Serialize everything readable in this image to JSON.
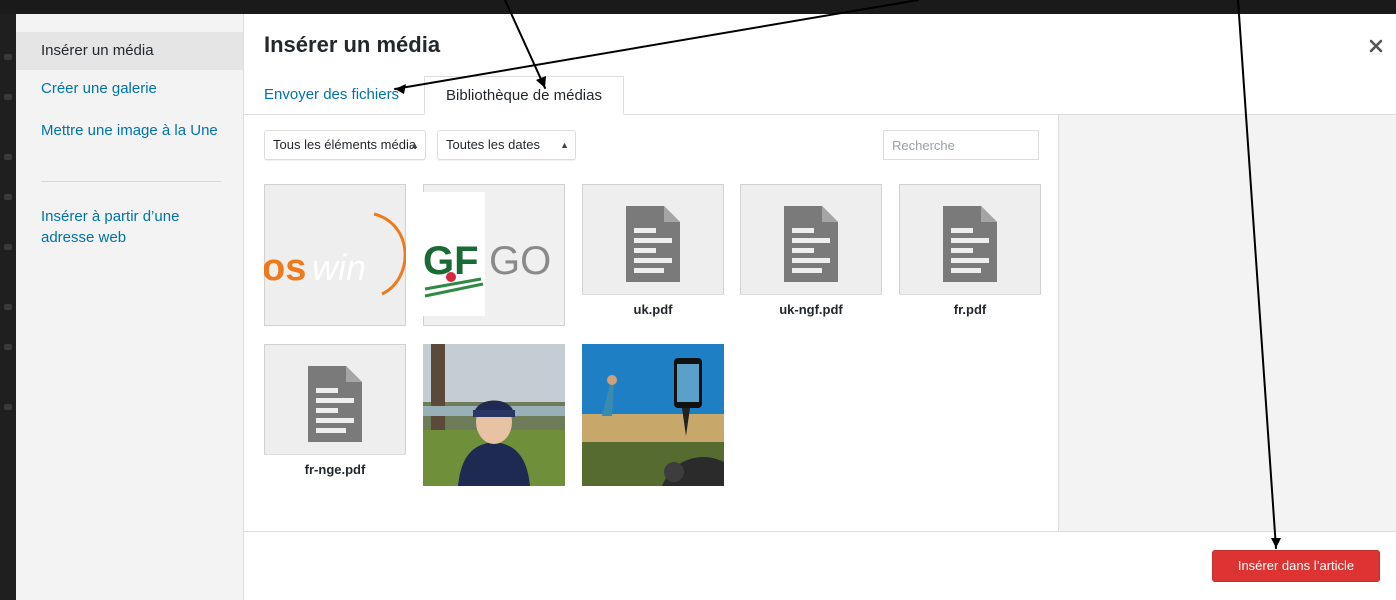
{
  "sidebar": {
    "items": [
      {
        "label": "Insérer un média",
        "active": true
      },
      {
        "label": "Créer une galerie",
        "active": false
      },
      {
        "label": "Mettre une image à la Une",
        "active": false
      },
      {
        "label": "Insérer à partir d’une adresse web",
        "active": false
      }
    ]
  },
  "header": {
    "title": "Insérer un média",
    "close_icon": "close-icon"
  },
  "tabs": [
    {
      "label": "Envoyer des fichiers",
      "active": false
    },
    {
      "label": "Bibliothèque de médias",
      "active": true
    }
  ],
  "toolbar": {
    "type_filter": "Tous les éléments média",
    "date_filter": "Toutes les dates",
    "search_placeholder": "Recherche"
  },
  "media": [
    {
      "kind": "image",
      "name": "oswing-logo"
    },
    {
      "kind": "image",
      "name": "ngf-golf-logo"
    },
    {
      "kind": "document",
      "filename": "uk.pdf"
    },
    {
      "kind": "document",
      "filename": "uk-ngf.pdf"
    },
    {
      "kind": "document",
      "filename": "fr.pdf"
    },
    {
      "kind": "document",
      "filename": "fr-nge.pdf"
    },
    {
      "kind": "image",
      "name": "photo-golfer-cap"
    },
    {
      "kind": "image",
      "name": "photo-golf-swing-phone"
    }
  ],
  "footer": {
    "insert_label": "Insérer dans l’article"
  },
  "colors": {
    "accent": "#0073aa",
    "primary_button": "#dd3333",
    "sidebar_bg": "#f3f3f3",
    "overlay": "#1a1a1a"
  }
}
